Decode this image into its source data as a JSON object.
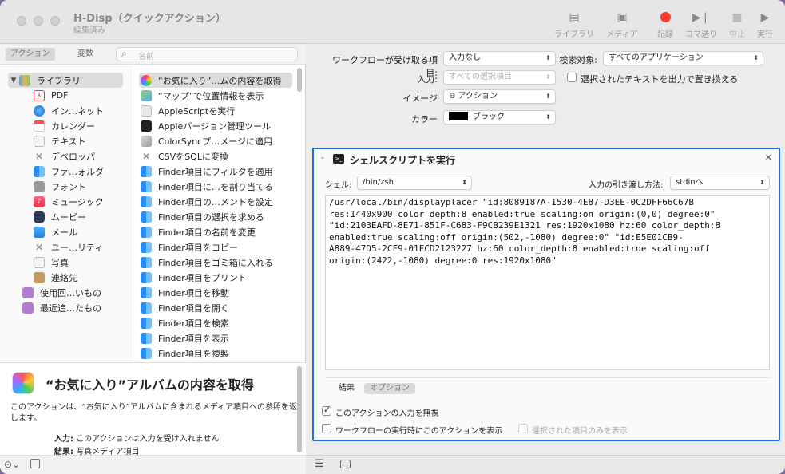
{
  "window": {
    "title": "H-Disp（クイックアクション）",
    "subtitle": "編集済み"
  },
  "toolbar": {
    "library": "ライブラリ",
    "media": "メディア",
    "record": "記録",
    "step": "コマ送り",
    "stop": "中止",
    "run": "実行"
  },
  "left": {
    "seg_actions": "アクション",
    "seg_variables": "変数",
    "search_placeholder": "名前",
    "library": [
      {
        "label": "ライブラリ",
        "icon": "library-icon"
      },
      {
        "label": "PDF",
        "icon": "pdf-icon"
      },
      {
        "label": "イン…ネット",
        "icon": "internet-icon"
      },
      {
        "label": "カレンダー",
        "icon": "calendar-icon"
      },
      {
        "label": "テキスト",
        "icon": "text-icon"
      },
      {
        "label": "デベロッパ",
        "icon": "developer-icon"
      },
      {
        "label": "ファ…ォルダ",
        "icon": "finder-icon"
      },
      {
        "label": "フォント",
        "icon": "font-icon"
      },
      {
        "label": "ミュージック",
        "icon": "music-icon"
      },
      {
        "label": "ムービー",
        "icon": "movie-icon"
      },
      {
        "label": "メール",
        "icon": "mail-icon"
      },
      {
        "label": "ユー…リティ",
        "icon": "utility-icon"
      },
      {
        "label": "写真",
        "icon": "photo-icon"
      },
      {
        "label": "連絡先",
        "icon": "contacts-icon"
      },
      {
        "label": "使用回…いもの",
        "icon": "smart-folder-icon"
      },
      {
        "label": "最近追…たもの",
        "icon": "smart-folder-icon"
      }
    ],
    "actions": [
      "“お気に入り”…ムの内容を取得",
      "“マップ”で位置情報を表示",
      "AppleScriptを実行",
      "Appleバージョン管理ツール",
      "ColorSyncプ…メージに適用",
      "CSVをSQLに変換",
      "Finder項目にフィルタを適用",
      "Finder項目に…を割り当てる",
      "Finder項目の…メントを設定",
      "Finder項目の選択を求める",
      "Finder項目の名前を変更",
      "Finder項目をコピー",
      "Finder項目をゴミ箱に入れる",
      "Finder項目をプリント",
      "Finder項目を移動",
      "Finder項目を開く",
      "Finder項目を検索",
      "Finder項目を表示",
      "Finder項目を複製"
    ],
    "desc_title": "“お気に入り”アルバムの内容を取得",
    "desc_body": "このアクションは、“お気に入り”アルバムに含まれるメディア項目への参照を返します。",
    "input_label": "入力:",
    "input_value": "このアクションは入力を受け入れません",
    "result_label": "結果:",
    "result_value": "写真メディア項目"
  },
  "main": {
    "receives_label": "ワークフローが受け取る項目:",
    "receives_value": "入力なし",
    "search_label": "検索対象:",
    "search_value": "すべてのアプリケーション",
    "input_label": "入力:",
    "input_value": "すべての選択項目",
    "replace_label": "選択されたテキストを出力で置き換える",
    "image_label": "イメージ",
    "image_value": "⊖ アクション",
    "color_label": "カラー",
    "color_value": "ブラック",
    "color_swatch": "#000000"
  },
  "action": {
    "title": "シェルスクリプトを実行",
    "shell_label": "シェル:",
    "shell_value": "/bin/zsh",
    "pass_label": "入力の引き渡し方法:",
    "pass_value": "stdinへ",
    "script_lines": [
      "/usr/local/bin/displayplacer \"id:8089187A-1530-4E87-D3EE-0C2DFF66C67B",
      "res:1440x900 color_depth:8 enabled:true scaling:on origin:(0,0) degree:0\"",
      "\"id:2103EAFD-8E71-851F-C683-F9CB239E1321 res:1920x1080 hz:60 color_depth:8",
      "enabled:true scaling:off origin:(502,-1080) degree:0\" \"id:E5E01CB9-",
      "A889-47D5-2CF9-01FCD2123227 hz:60 color_depth:8 enabled:true scaling:off",
      "origin:(2422,-1080) degree:0 res:1920x1080\""
    ],
    "tab_results": "結果",
    "tab_options": "オプション",
    "ignore_input": "このアクションの入力を無視",
    "show_when_run": "ワークフローの実行時にこのアクションを表示",
    "selected_only": "選択された項目のみを表示"
  },
  "colors": {
    "accent": "#1e6fd9",
    "record": "#ff3b30"
  }
}
